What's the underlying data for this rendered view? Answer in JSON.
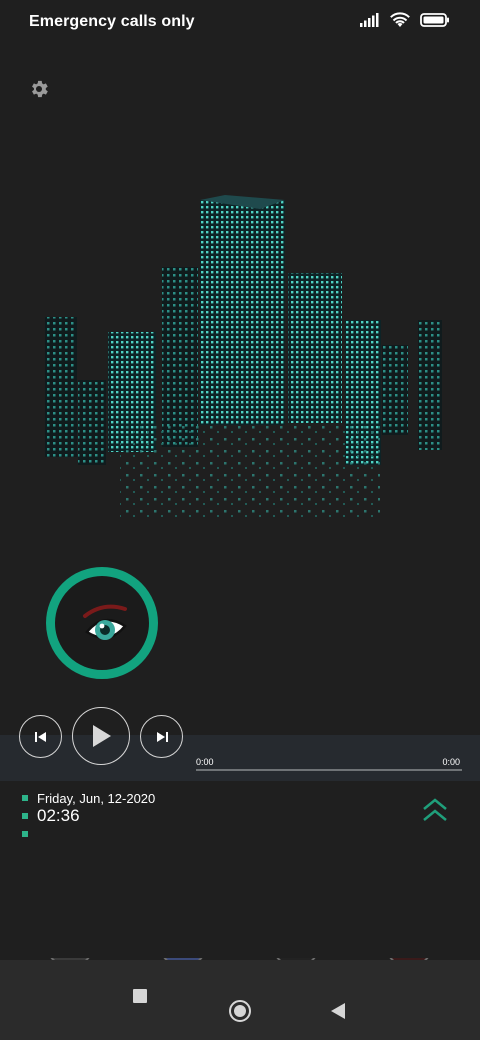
{
  "status_bar": {
    "carrier_text": "Emergency calls only",
    "icons": [
      "signal-icon",
      "wifi-icon",
      "battery-icon"
    ]
  },
  "settings": {
    "icon": "gear-icon"
  },
  "wallpaper": {
    "icon": "city-skyline-illustration",
    "accent_color": "#4fd3c4"
  },
  "avatar": {
    "icon": "eye-avatar",
    "ring_color": "#12a37f"
  },
  "player": {
    "controls": [
      "previous-icon",
      "play-icon",
      "next-icon"
    ],
    "elapsed": "0:00",
    "duration": "0:00",
    "progress": 0
  },
  "info": {
    "date": "Friday, Jun, 12-2020",
    "time": "02:36",
    "bullet_color": "#2db48a"
  },
  "expand": {
    "icon": "double-chevron-up-icon",
    "color": "#1f9f7b"
  },
  "nav_bar": {
    "buttons": [
      "recents-button",
      "home-button",
      "back-button"
    ]
  }
}
